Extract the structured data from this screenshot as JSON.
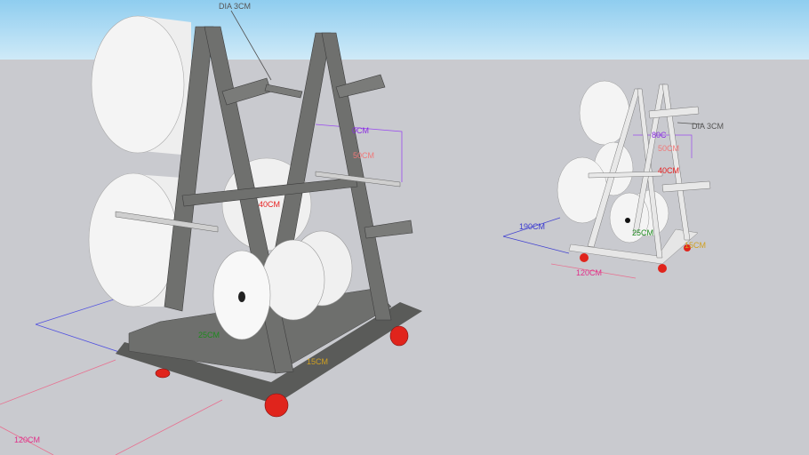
{
  "colors": {
    "sky_top": "#8fcdef",
    "sky_bottom": "#cfeaf8",
    "ground": "#c9cacf",
    "frame_dark": "#6d6e6c",
    "frame_light": "#e8e8e8",
    "roll": "#f4f4f4",
    "wheel": "#e0241c",
    "dim_blue": "#3a3ad0",
    "dim_purple": "#8a2be2",
    "dim_red": "#e82020",
    "dim_salmon": "#f07878",
    "dim_green": "#1e8a1e",
    "dim_orange": "#d0a020",
    "dim_pink": "#e0308a",
    "dim_gray": "#555555"
  },
  "large_model": {
    "labels": {
      "dia": "DIA 3CM",
      "width_top": "0CM",
      "spacing": "50CM",
      "height_arm": "40CM",
      "base_height": "25CM",
      "base_edge": "15CM",
      "length": "120CM"
    }
  },
  "small_model": {
    "labels": {
      "dia": "DIA 3CM",
      "width_top": "80C",
      "spacing": "50CM",
      "height_arm": "40CM",
      "depth": "190CM",
      "base_height": "25CM",
      "base_edge": "15CM",
      "length": "120CM"
    }
  }
}
